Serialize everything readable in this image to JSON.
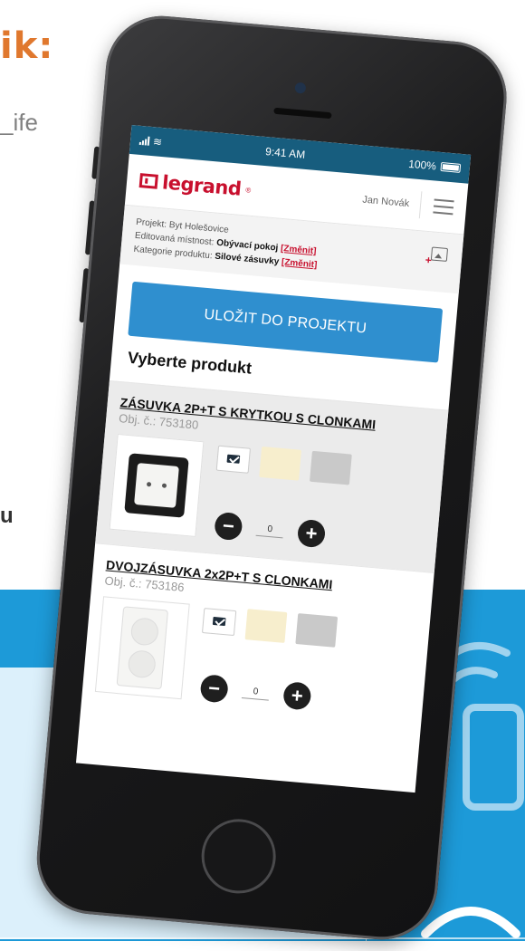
{
  "background": {
    "heading": "ik:",
    "subtext": "_ife",
    "side_letter": "u"
  },
  "status_bar": {
    "time": "9:41 AM",
    "battery_percent": "100%"
  },
  "header": {
    "logo_text": "legrand",
    "logo_reg": "®",
    "user_name": "Jan Novák"
  },
  "project": {
    "project_label": "Projekt:",
    "project_name": "Byt Holešovice",
    "room_label": "Editovaná místnost:",
    "room_value": "Obývací pokoj",
    "category_label": "Kategorie produktu:",
    "category_value": "Silové zásuvky",
    "change_link": "[Změnit]"
  },
  "save_button": "ULOŽIT DO PROJEKTU",
  "section_title": "Vyberte produkt",
  "products": [
    {
      "name": "ZÁSUVKA 2P+T S KRYTKOU S CLONKAMI",
      "code": "Obj. č.: 753180",
      "quantity": "0"
    },
    {
      "name": "DVOJZÁSUVKA 2x2P+T S CLONKAMI",
      "code": "Obj. č.: 753186",
      "quantity": "0"
    }
  ],
  "colors": {
    "status_bar": "#175d7e",
    "brand_red": "#c8102e",
    "button_blue": "#2f8fcf",
    "band_blue": "#1d9ad8",
    "heading_orange": "#e0782e",
    "swatch_ivory": "#f7eecd",
    "swatch_grey": "#c9c9c9"
  }
}
